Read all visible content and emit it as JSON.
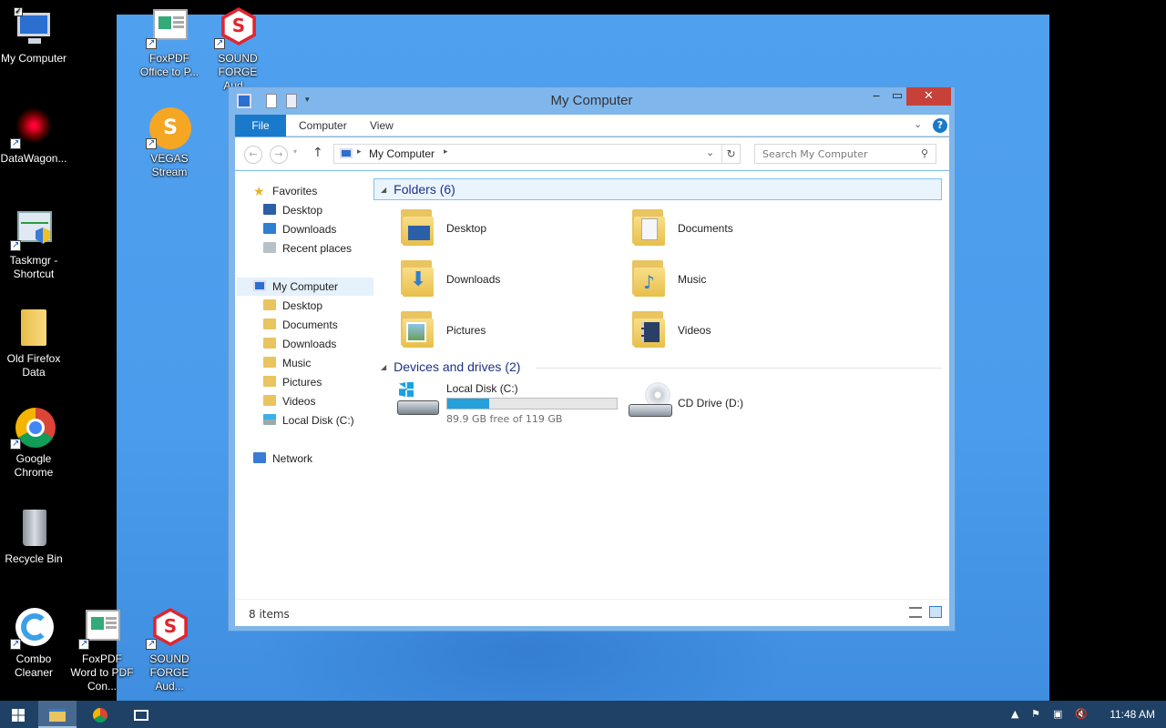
{
  "desktop": {
    "icons": [
      {
        "label": "My Computer"
      },
      {
        "label": "DataWagon..."
      },
      {
        "label": "Taskmgr - Shortcut"
      },
      {
        "label": "Old Firefox Data"
      },
      {
        "label": "Google Chrome"
      },
      {
        "label": "Recycle Bin"
      },
      {
        "label": "Combo Cleaner"
      },
      {
        "label": "FoxPDF Office to P..."
      },
      {
        "label": "SOUND FORGE Aud..."
      },
      {
        "label": "VEGAS Stream"
      },
      {
        "label": "FoxPDF Word to PDF Con..."
      },
      {
        "label": "SOUND FORGE Aud..."
      }
    ]
  },
  "window": {
    "title": "My Computer",
    "ribbon": {
      "tabs": [
        "File",
        "Computer",
        "View"
      ]
    },
    "address": {
      "crumb": "My Computer",
      "search_placeholder": "Search My Computer"
    },
    "nav": {
      "favorites": "Favorites",
      "favorites_items": [
        "Desktop",
        "Downloads",
        "Recent places"
      ],
      "computer": "My Computer",
      "computer_items": [
        "Desktop",
        "Documents",
        "Downloads",
        "Music",
        "Pictures",
        "Videos",
        "Local Disk (C:)"
      ],
      "network": "Network"
    },
    "content": {
      "folders_header": "Folders (6)",
      "folders": [
        "Desktop",
        "Documents",
        "Downloads",
        "Music",
        "Pictures",
        "Videos"
      ],
      "devices_header": "Devices and drives (2)",
      "drives": [
        {
          "name": "Local Disk (C:)",
          "detail": "89.9 GB free of 119 GB",
          "used_fraction": 0.245
        },
        {
          "name": "CD Drive (D:)"
        }
      ]
    },
    "status": {
      "count": "8 items"
    }
  },
  "taskbar": {
    "clock": "11:48 AM"
  },
  "colors": {
    "accent": "#1979ca",
    "close": "#c7413a",
    "taskbar": "#1f4166",
    "wallpaper": "#4b9cec"
  }
}
